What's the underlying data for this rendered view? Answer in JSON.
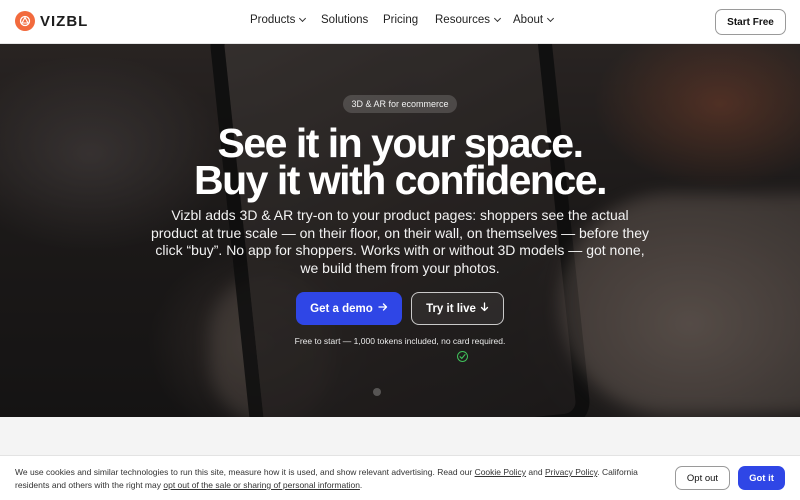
{
  "header": {
    "brand": "VIZBL",
    "nav": [
      {
        "label": "Products",
        "has_dropdown": true
      },
      {
        "label": "Solutions",
        "has_dropdown": false
      },
      {
        "label": "Pricing",
        "has_dropdown": false
      },
      {
        "label": "Resources",
        "has_dropdown": true
      },
      {
        "label": "About",
        "has_dropdown": true
      }
    ],
    "cta": "Start Free"
  },
  "hero": {
    "badge": "3D & AR for ecommerce",
    "headline_1": "See it in your space.",
    "headline_2": "Buy it with confidence.",
    "subtext": "Vizbl adds 3D & AR try-on to your product pages: shoppers see the actual product at true scale — on their floor, on their wall, on themselves — before they click “buy”. No app for shoppers. Works with or without 3D models — got none, we build them from your photos.",
    "primary_button": "Get a demo",
    "secondary_button": "Try it live",
    "note": "Free to start — 1,000 tokens included, no card required."
  },
  "cookie": {
    "text_1": "We use cookies and similar technologies to run this site, measure how it is used, and show relevant advertising. Read our ",
    "cookie_policy": "Cookie Policy",
    "and": " and ",
    "privacy_policy": "Privacy Policy",
    "text_2": ". California residents and others with the right may ",
    "opt_out_link": "opt out of the sale or sharing of personal information",
    "text_3": ".",
    "opt_out_button": "Opt out",
    "accept_button": "Got it"
  },
  "colors": {
    "brand_orange": "#f26a3d",
    "primary_blue": "#2f46e6"
  }
}
